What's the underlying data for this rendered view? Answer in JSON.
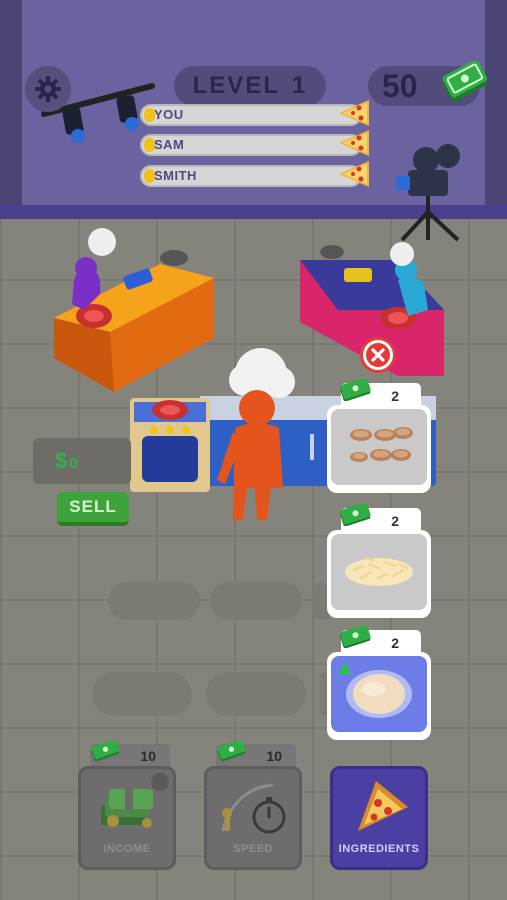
{
  "hud": {
    "level_label": "LEVEL",
    "level_number": "1",
    "money": "50"
  },
  "race": [
    {
      "name": "YOU",
      "progress": 0.05
    },
    {
      "name": "SAM",
      "progress": 0.05
    },
    {
      "name": "SMITH",
      "progress": 0.05
    }
  ],
  "cash_box": {
    "symbol": "$",
    "amount": "0"
  },
  "sell_label": "SELL",
  "ingredients": [
    {
      "name": "sausage",
      "price": "2",
      "selected": false
    },
    {
      "name": "cheese",
      "price": "2",
      "selected": false
    },
    {
      "name": "dough",
      "price": "2",
      "selected": true
    }
  ],
  "upgrades": [
    {
      "label": "INCOME",
      "price": "10",
      "icon": "cash-stack-icon"
    },
    {
      "label": "SPEED",
      "price": "10",
      "icon": "stopwatch-icon"
    },
    {
      "label": "INGREDIENTS",
      "price": "",
      "icon": "pizza-slice-icon"
    }
  ],
  "colors": {
    "wall": "#6b639f",
    "accent_blue": "#6c7de8",
    "sell_green": "#3fa33c",
    "close_red": "#e33b3b"
  }
}
